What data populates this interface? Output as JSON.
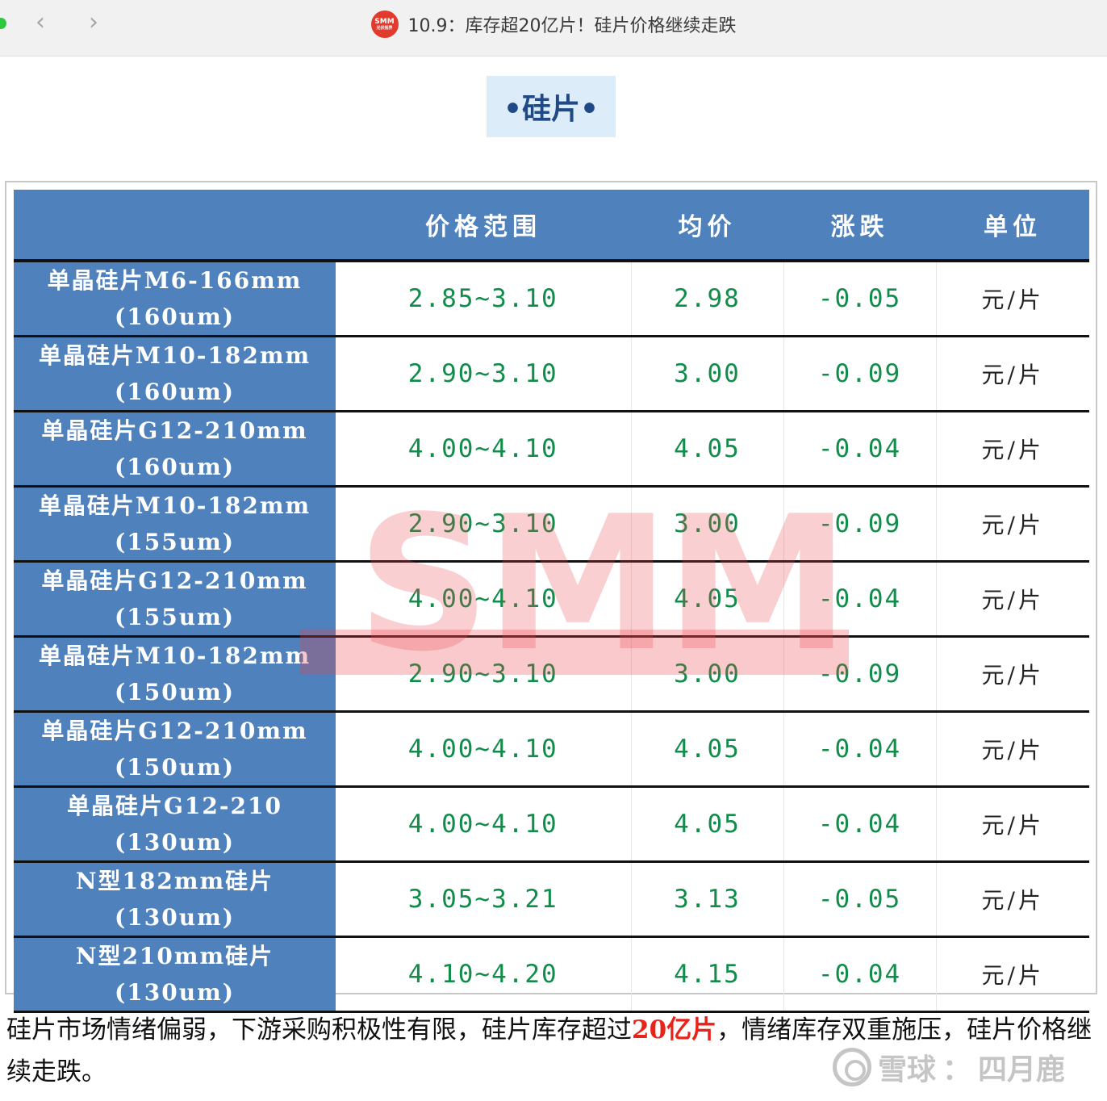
{
  "window": {
    "title": "10.9：库存超20亿片！硅片价格继续走跌",
    "back_glyph": "‹",
    "forward_glyph": "›",
    "logo_text": "SMM",
    "logo_subtext": "光伏视界"
  },
  "section": {
    "heading": "•硅片•"
  },
  "table": {
    "headers": [
      "",
      "价格范围",
      "均价",
      "涨跌",
      "单位"
    ],
    "rows": [
      {
        "spec_line1": "单晶硅片M6-166mm",
        "spec_line2": "(160um)",
        "range": "2.85~3.10",
        "avg": "2.98",
        "change": "-0.05",
        "unit": "元/片"
      },
      {
        "spec_line1": "单晶硅片M10-182mm",
        "spec_line2": "(160um)",
        "range": "2.90~3.10",
        "avg": "3.00",
        "change": "-0.09",
        "unit": "元/片"
      },
      {
        "spec_line1": "单晶硅片G12-210mm",
        "spec_line2": "(160um)",
        "range": "4.00~4.10",
        "avg": "4.05",
        "change": "-0.04",
        "unit": "元/片"
      },
      {
        "spec_line1": "单晶硅片M10-182mm",
        "spec_line2": "(155um)",
        "range": "2.90~3.10",
        "avg": "3.00",
        "change": "-0.09",
        "unit": "元/片"
      },
      {
        "spec_line1": "单晶硅片G12-210mm",
        "spec_line2": "(155um)",
        "range": "4.00~4.10",
        "avg": "4.05",
        "change": "-0.04",
        "unit": "元/片"
      },
      {
        "spec_line1": "单晶硅片M10-182mm",
        "spec_line2": "(150um)",
        "range": "2.90~3.10",
        "avg": "3.00",
        "change": "-0.09",
        "unit": "元/片"
      },
      {
        "spec_line1": "单晶硅片G12-210mm",
        "spec_line2": "(150um)",
        "range": "4.00~4.10",
        "avg": "4.05",
        "change": "-0.04",
        "unit": "元/片"
      },
      {
        "spec_line1": "单晶硅片G12-210",
        "spec_line2": "(130um)",
        "range": "4.00~4.10",
        "avg": "4.05",
        "change": "-0.04",
        "unit": "元/片"
      },
      {
        "spec_line1": "N型182mm硅片",
        "spec_line2": "(130um)",
        "range": "3.05~3.21",
        "avg": "3.13",
        "change": "-0.05",
        "unit": "元/片"
      },
      {
        "spec_line1": "N型210mm硅片",
        "spec_line2": "(130um)",
        "range": "4.10~4.20",
        "avg": "4.15",
        "change": "-0.04",
        "unit": "元/片"
      }
    ],
    "watermark_text": "SMM",
    "value_color": "#118c4a",
    "header_color": "#4f81bd"
  },
  "article": {
    "text_before": "硅片市场情绪偏弱，下游采购积极性有限，硅片库存超过",
    "highlight": "20亿片",
    "text_after": "，情绪库存双重施压，硅片价格继续走跌。",
    "highlight_color": "#e8231a"
  },
  "source_watermark": {
    "brand": "雪球",
    "separator": "：",
    "author": "四月鹿"
  }
}
